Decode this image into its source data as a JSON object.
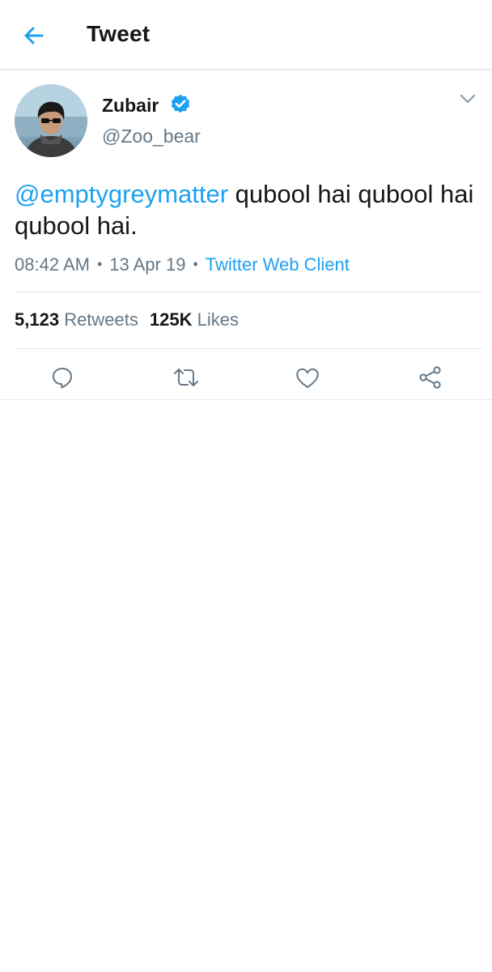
{
  "header": {
    "title": "Tweet",
    "back_icon": "arrow-left-icon"
  },
  "tweet": {
    "author": {
      "name": "Zubair",
      "handle": "@Zoo_bear",
      "verified_icon": "verified-badge-icon"
    },
    "text": {
      "mention": "@emptygreymatter",
      "body": " qubool hai qubool hai qubool hai."
    },
    "meta": {
      "time": "08:42 AM",
      "date": "13 Apr 19",
      "separator": "•",
      "client": "Twitter Web Client"
    },
    "stats": {
      "retweets_count": "5,123",
      "retweets_label": "Retweets",
      "likes_count": "125K",
      "likes_label": "Likes"
    },
    "actions": [
      "reply-icon",
      "retweet-icon",
      "like-icon",
      "share-icon"
    ]
  },
  "colors": {
    "accent": "#1da1f2",
    "text_primary": "#14171a",
    "text_secondary": "#657786",
    "divider": "#e1e8ed"
  }
}
